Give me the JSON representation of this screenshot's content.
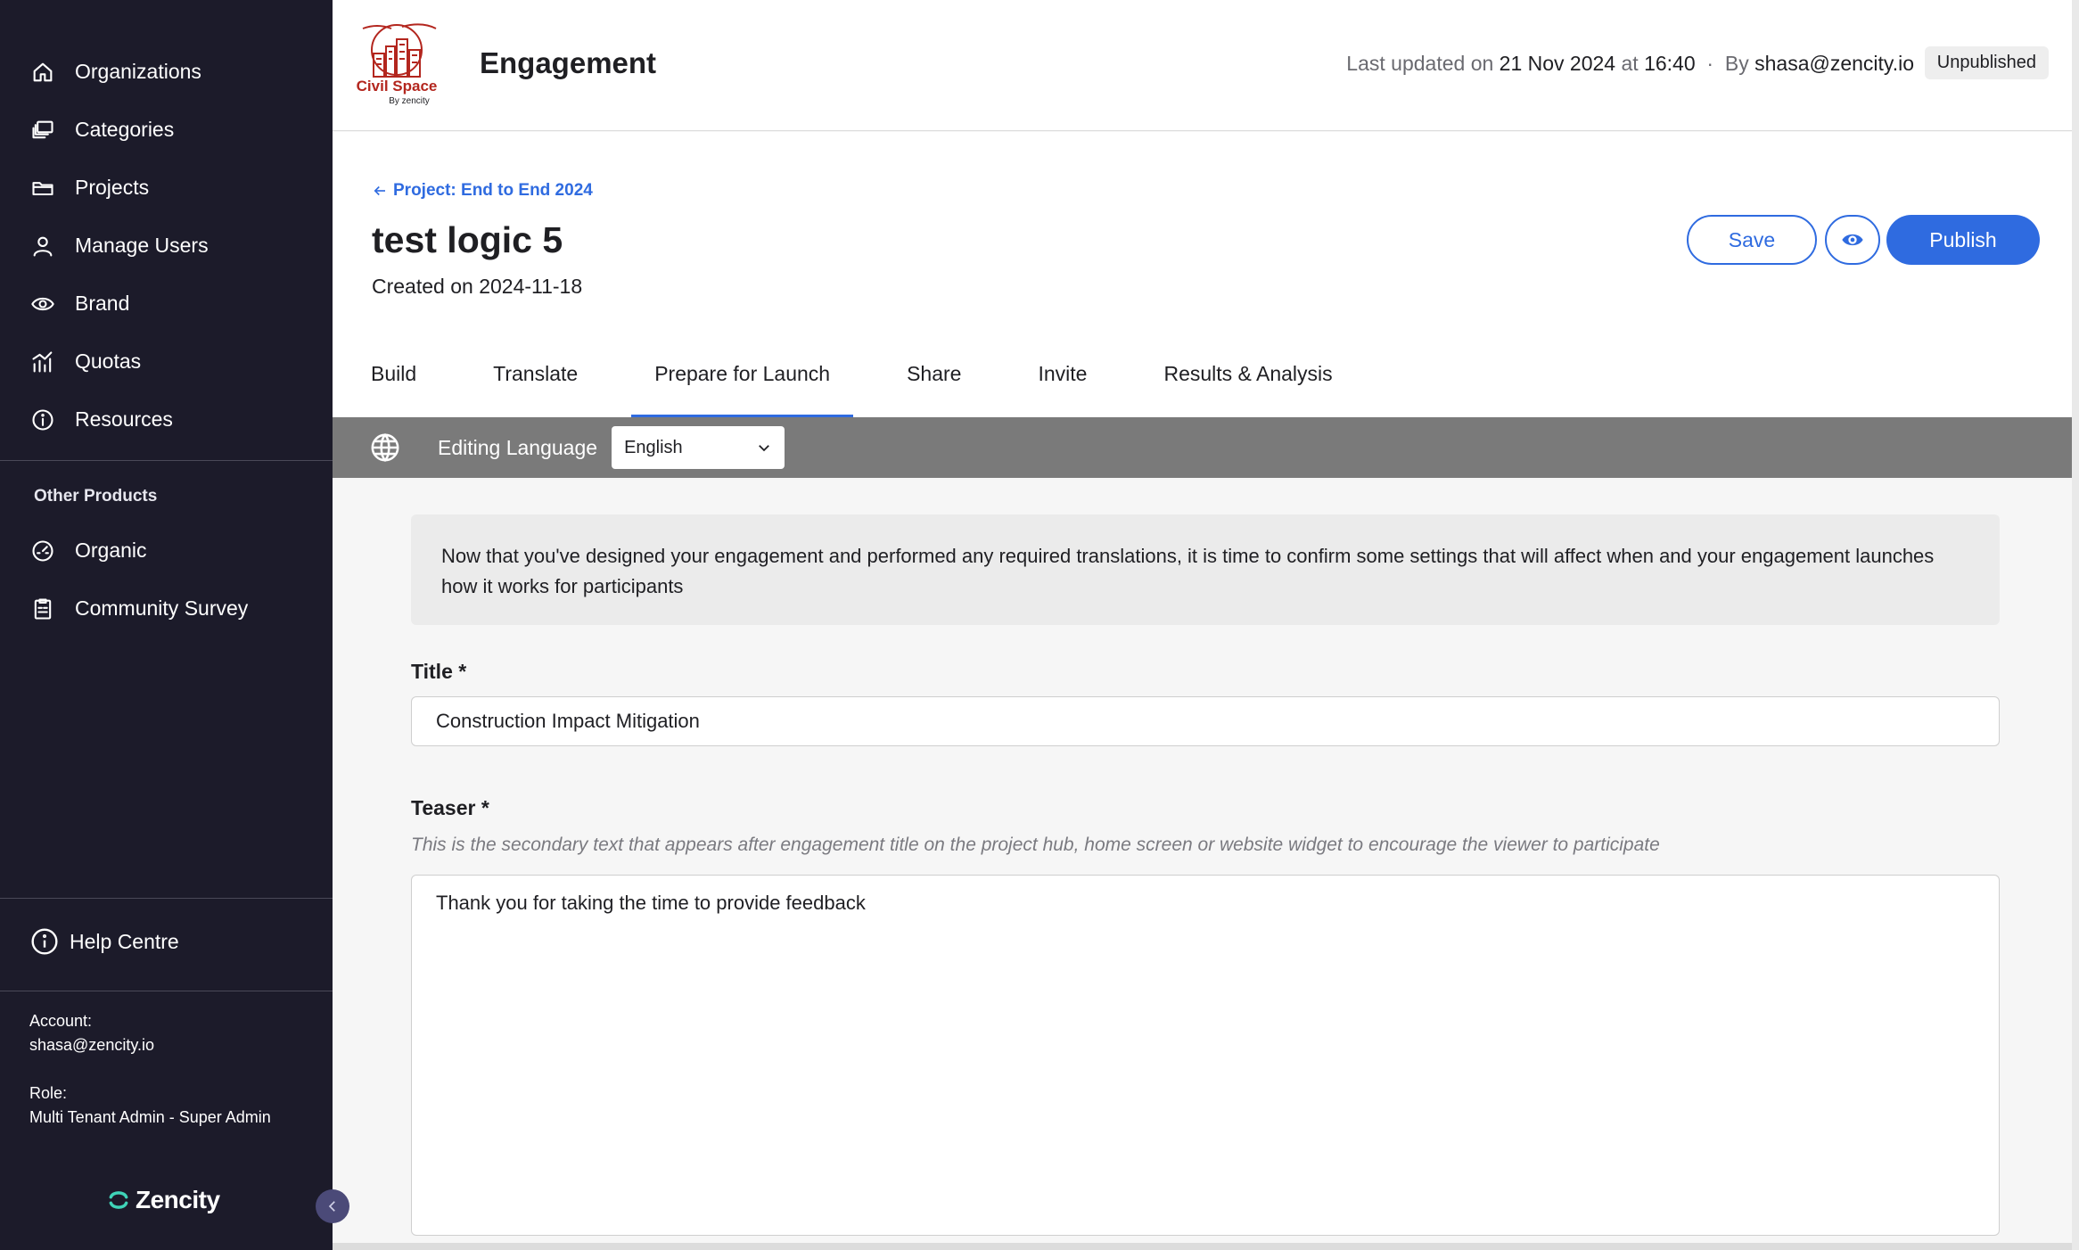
{
  "sidebar": {
    "items": [
      {
        "label": "Organizations",
        "icon": "home-icon"
      },
      {
        "label": "Categories",
        "icon": "layers-icon"
      },
      {
        "label": "Projects",
        "icon": "folder-icon"
      },
      {
        "label": "Manage Users",
        "icon": "user-icon"
      },
      {
        "label": "Brand",
        "icon": "eye-icon"
      },
      {
        "label": "Quotas",
        "icon": "chart-icon"
      },
      {
        "label": "Resources",
        "icon": "info-icon"
      }
    ],
    "other_title": "Other Products",
    "other_items": [
      {
        "label": "Organic",
        "icon": "gauge-icon"
      },
      {
        "label": "Community Survey",
        "icon": "clipboard-icon"
      }
    ],
    "help_label": "Help Centre",
    "account_label": "Account:",
    "account_value": "shasa@zencity.io",
    "role_label": "Role:",
    "role_value": "Multi Tenant Admin - Super Admin",
    "brand_name": "Zencity"
  },
  "header": {
    "logo_text": "Civil Space",
    "logo_sub": "By zencity",
    "title": "Engagement",
    "meta_prefix": "Last updated on",
    "meta_date": "21 Nov 2024",
    "meta_at": "at",
    "meta_time": "16:40",
    "meta_sep": "·",
    "meta_by": "By",
    "meta_user": "shasa@zencity.io",
    "status": "Unpublished"
  },
  "page": {
    "back_link": "Project: End to End 2024",
    "title": "test logic 5",
    "created": "Created on 2024-11-18",
    "save_label": "Save",
    "publish_label": "Publish",
    "tabs": [
      "Build",
      "Translate",
      "Prepare for Launch",
      "Share",
      "Invite",
      "Results & Analysis"
    ],
    "active_tab": "Prepare for Launch"
  },
  "language": {
    "label": "Editing Language",
    "selected": "English"
  },
  "form": {
    "info": "Now that you've designed your engagement and performed any required translations, it is time to confirm some settings that will affect when and your engagement launches how it works for participants",
    "title_label": "Title *",
    "title_value": "Construction Impact Mitigation",
    "teaser_label": "Teaser *",
    "teaser_hint": "This is the secondary text that appears after engagement title on the project hub, home screen or website widget to encourage the viewer to participate",
    "teaser_value": "Thank you for taking the time to provide feedback"
  },
  "colors": {
    "sidebar_bg": "#1c1b2a",
    "accent": "#2f6be0",
    "lang_bar": "#7a7a7a",
    "logo_red": "#b3261e"
  }
}
